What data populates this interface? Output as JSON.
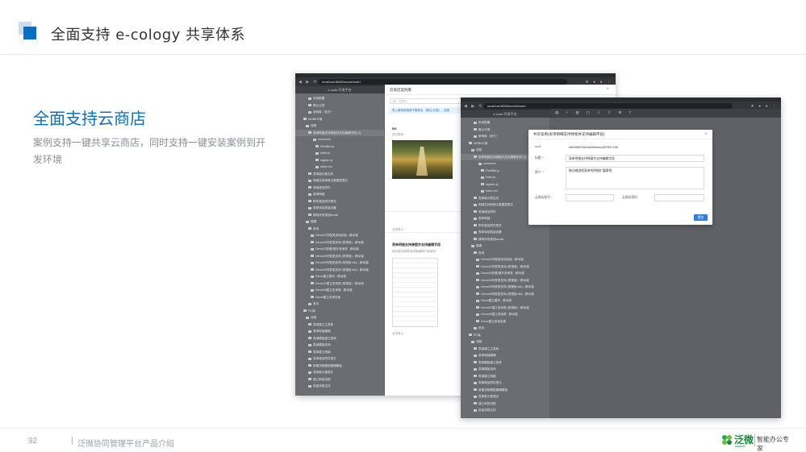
{
  "slide": {
    "title": "全面支持 e-cology 共享体系",
    "subtitle": "全面支持云商店",
    "description": "案例支持一键共享云商店，同时支持一键安装案例到开发环境",
    "page_number": "92",
    "footer_sep": "|",
    "footer_text": "泛微协同管理平台产品介绍",
    "logo_name": "泛微",
    "logo_en": "weaver",
    "logo_slogan": "智能办公专家"
  },
  "window1": {
    "url": "localhost:8080/ecode/main",
    "app_title": "e-code 开发平台",
    "tree": [
      "系统配置",
      "默认分类",
      "案例库（官方）",
      "MOBILE端",
      "流程",
      "表单明细支持弹窗并支持编辑字段 (1)",
      "resources",
      "FieldBtn.js",
      "index.js",
      "register.js",
      "index.md",
      "表单新元素支持",
      "明细支持转移大数据表提交",
      "表单增加附件",
      "表单明细",
      "附件增加附件预览",
      "表单添加数量设置",
      "移除所有按钮ecode",
      "建模",
      "查询",
      "Demo01列表类查询页面 - 移动端",
      "Demo02列表类查询 (带搜索) - 移动端",
      "Demo03折叠/展开查询表 - 移动端",
      "Demo04列表类查询 (带搜索) - 移动端",
      "Demo05列表类查询 (带搜索 tab) - 移动端",
      "Demo06列表类查询 (带搜索 tab) - 移动端",
      "Demo建立模块 - 移动端",
      "Demo07建立查询表 (带搜索) - 移动端",
      "Demo08建立查询表 - 移动端",
      "Demo建立查询页面",
      "首页",
      "PC端",
      "流程",
      "表单建立主表单",
      "表单明细编辑",
      "表单模板建立表单",
      "表单模板查询",
      "表单建立明细",
      "表单增加附件提交",
      "新建流程模型编辑模板",
      "表单新元素提交",
      "建立审批流程",
      "批量流程支持"
    ],
    "drawer": {
      "title": "云商店案例库",
      "search_placeholder": "输入关键词",
      "notice": "导入案例请选择下载导出 【默认分类】，还原",
      "card1_title": "BS",
      "card1_desc": "测试案例",
      "card1_action": "点击导入",
      "card2_title": "表单明细支持弹窗并支持编辑字段",
      "card2_desc": "移动端流程表单明细编辑扩展案例",
      "card2_action": "点击导入"
    }
  },
  "window2": {
    "url": "localhost:8080/ecode/main",
    "app_title": "e-code 开发平台",
    "toolbar_icons": "▤ + ▥ ▢ ⇩ ⇧ ⚙ ?",
    "modal": {
      "title": "共享案例(表单明细支持弹窗并支持编辑字段)",
      "uuid_label": "uuid",
      "uuid_value": "e8035697bb24a00bebcc607847159",
      "title_label": "标题",
      "title_value": "表单明细支持弹窗并支持编辑字段",
      "intro_label": "简介",
      "intro_value": "移动端流程表单的明细扩展案例",
      "account_label": "云商店账号",
      "password_label": "云商店密码",
      "required_mark": "*",
      "save_label": "提交"
    }
  },
  "colors": {
    "accent": "#0a6fc2",
    "logo_green": "#1a8a3a"
  }
}
